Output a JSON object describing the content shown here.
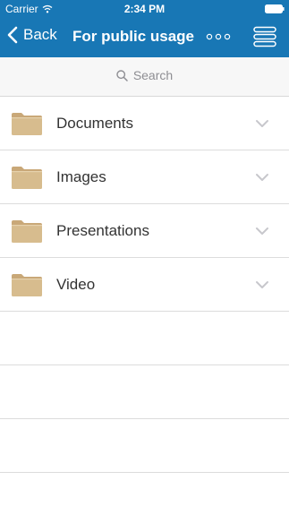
{
  "status_bar": {
    "carrier": "Carrier",
    "time": "2:34 PM"
  },
  "nav": {
    "back_label": "Back",
    "title": "For public usage"
  },
  "search": {
    "placeholder": "Search"
  },
  "folders": [
    {
      "label": "Documents",
      "icon": "folder-icon"
    },
    {
      "label": "Images",
      "icon": "folder-icon"
    },
    {
      "label": "Presentations",
      "icon": "folder-icon"
    },
    {
      "label": "Video",
      "icon": "folder-icon"
    }
  ],
  "colors": {
    "accent": "#1877b5",
    "folder": "#d7bc8e",
    "chevron": "#c7c7cc"
  }
}
